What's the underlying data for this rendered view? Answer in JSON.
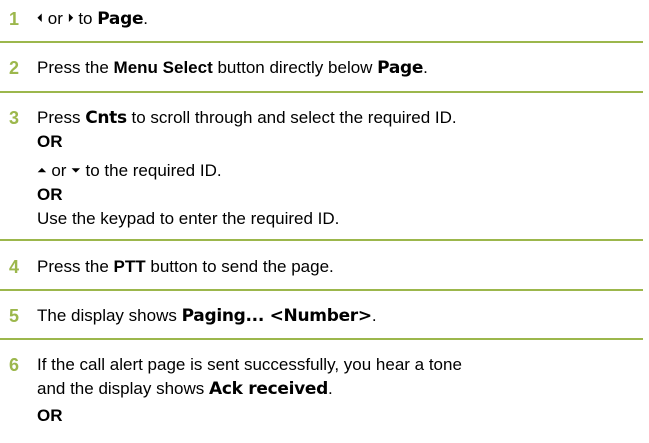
{
  "colors": {
    "accent": "#9cb74c"
  },
  "steps": [
    {
      "num": "1",
      "text": {
        "left_arrow": "⏴",
        "or": " or ",
        "right_arrow": "⏵",
        "to": " to ",
        "page": "Page",
        "end": "."
      }
    },
    {
      "num": "2",
      "text": {
        "a": "Press the ",
        "menu_select": "Menu Select",
        "b": " button directly below ",
        "page": "Page",
        "end": "."
      }
    },
    {
      "num": "3",
      "text": {
        "a": "Press ",
        "cnts": "Cnts",
        "b": " to scroll through and select the required ID.",
        "or1": "OR",
        "up": "⏶",
        "or_word": " or ",
        "down": "⏷",
        "c": " to the required ID.",
        "or2": "OR",
        "d": "Use the keypad to enter the required ID."
      }
    },
    {
      "num": "4",
      "text": {
        "a": "Press the ",
        "ptt": "PTT",
        "b": " button to send the page."
      }
    },
    {
      "num": "5",
      "text": {
        "a": "The display shows ",
        "paging": "Paging... <Number>",
        "end": "."
      }
    },
    {
      "num": "6",
      "text": {
        "line1": "If the call alert page is sent successfully, you hear a tone",
        "a": "and the display shows ",
        "ack": "Ack received",
        "end": ".",
        "or": "OR"
      }
    }
  ]
}
